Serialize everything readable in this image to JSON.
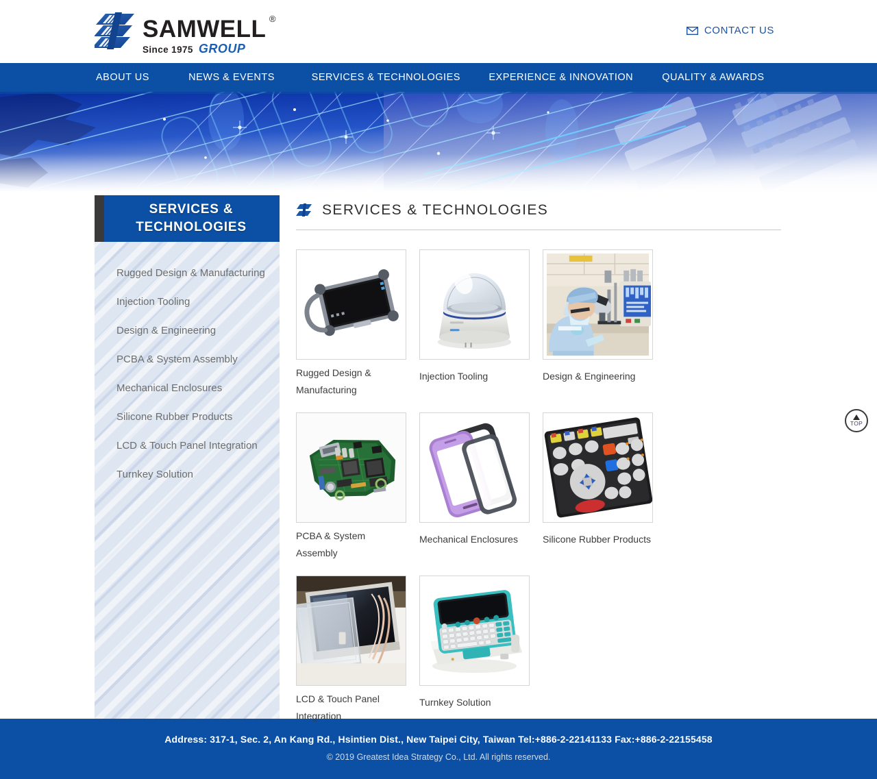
{
  "header": {
    "logo": {
      "name": "SAMWELL",
      "registered": "®",
      "since": "Since 1975",
      "group": "GROUP",
      "mark_icon": "samwell-logo-mark"
    },
    "contact": {
      "label": "CONTACT US",
      "icon": "mail-icon"
    }
  },
  "nav": {
    "items": [
      {
        "label": "ABOUT US"
      },
      {
        "label": "NEWS & EVENTS"
      },
      {
        "label": "SERVICES & TECHNOLOGIES"
      },
      {
        "label": "EXPERIENCE & INNOVATION"
      },
      {
        "label": "QUALITY & AWARDS"
      }
    ]
  },
  "hero": {
    "alt": "blue circuit board technology banner"
  },
  "sidebar": {
    "title": "SERVICES & TECHNOLOGIES",
    "title_line1": "SERVICES &",
    "title_line2": "TECHNOLOGIES",
    "items": [
      {
        "label": "Rugged Design & Manufacturing"
      },
      {
        "label": "Injection Tooling"
      },
      {
        "label": "Design & Engineering"
      },
      {
        "label": "PCBA & System Assembly"
      },
      {
        "label": "Mechanical Enclosures"
      },
      {
        "label": "Silicone Rubber Products"
      },
      {
        "label": "LCD & Touch Panel Integration"
      },
      {
        "label": "Turnkey Solution"
      }
    ]
  },
  "main": {
    "title": "SERVICES & TECHNOLOGIES",
    "title_icon": "samwell-mark-icon",
    "cards": [
      {
        "label": "Rugged Design & Manufacturing",
        "image": "rugged-tablet-image"
      },
      {
        "label": "Injection Tooling",
        "image": "dome-camera-housing-image"
      },
      {
        "label": "Design & Engineering",
        "image": "engineer-microscope-image"
      },
      {
        "label": "PCBA & System Assembly",
        "image": "green-circuit-board-image"
      },
      {
        "label": "Mechanical Enclosures",
        "image": "phone-bezel-enclosure-image"
      },
      {
        "label": "Silicone Rubber Products",
        "image": "rubber-keypad-image"
      },
      {
        "label": "LCD & Touch Panel Integration",
        "image": "lcd-touch-panel-image"
      },
      {
        "label": "Turnkey Solution",
        "image": "teal-handheld-terminal-image"
      }
    ]
  },
  "scroll_top": {
    "label": "TOP",
    "icon": "arrow-up-icon"
  },
  "footer": {
    "address": "Address: 317-1, Sec. 2, An Kang Rd., Hsintien Dist., New Taipei City, Taiwan    Tel:+886-2-22141133    Fax:+886-2-22155458",
    "copyright": "© 2019 Greatest Idea Strategy Co., Ltd. All rights reserved."
  },
  "colors": {
    "brand_blue": "#0b50a4",
    "logo_blue": "#1c5fb0",
    "sidebar_bg": "#dee6f2",
    "text_gray": "#6d6d6d"
  }
}
